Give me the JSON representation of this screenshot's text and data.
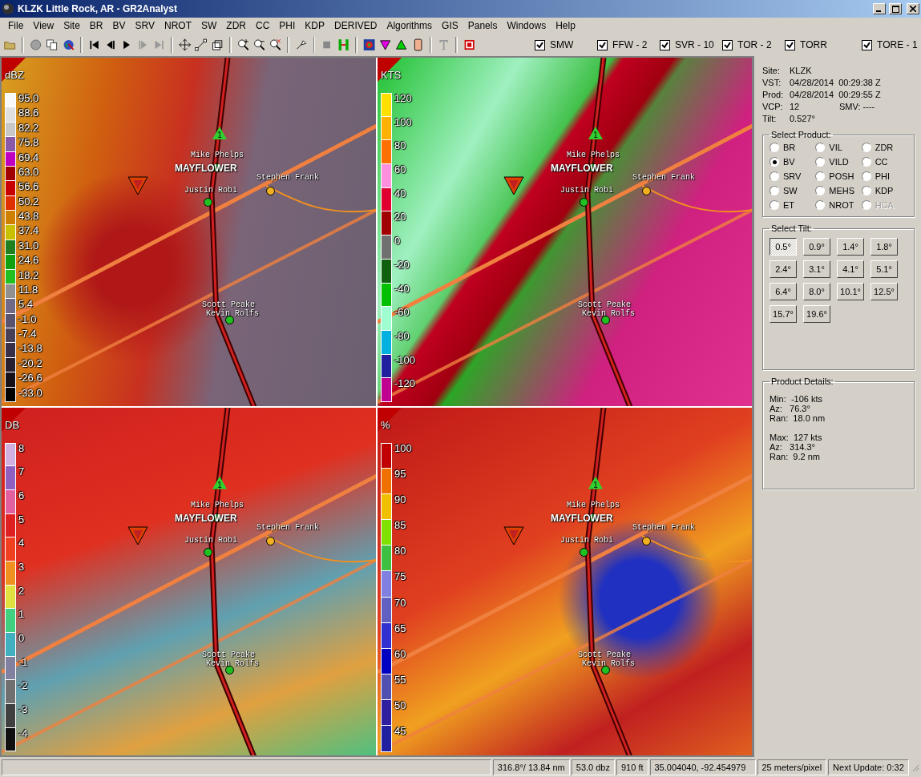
{
  "window": {
    "title": "KLZK Little Rock, AR - GR2Analyst"
  },
  "menu": [
    "File",
    "View",
    "Site",
    "BR",
    "BV",
    "SRV",
    "NROT",
    "SW",
    "ZDR",
    "CC",
    "PHI",
    "KDP",
    "DERIVED",
    "Algorithms",
    "GIS",
    "Panels",
    "Windows",
    "Help"
  ],
  "warning_toggles": [
    {
      "label": "SMW",
      "checked": true
    },
    {
      "label": "FFW - 2",
      "checked": true
    },
    {
      "label": "SVR - 10",
      "checked": true
    },
    {
      "label": "TOR - 2",
      "checked": true
    },
    {
      "label": "TORR",
      "checked": true
    },
    {
      "label": "TORE - 1",
      "checked": true
    }
  ],
  "panels": [
    {
      "unit": "dBZ",
      "scale": [
        {
          "label": "95.0",
          "color": "#f8f8f8"
        },
        {
          "label": "88.6",
          "color": "#e0e0e0"
        },
        {
          "label": "82.2",
          "color": "#c8c8c8"
        },
        {
          "label": "75.8",
          "color": "#8a5aa8"
        },
        {
          "label": "69.4",
          "color": "#c000c0"
        },
        {
          "label": "63.0",
          "color": "#a00000"
        },
        {
          "label": "56.6",
          "color": "#c80000"
        },
        {
          "label": "50.2",
          "color": "#e03000"
        },
        {
          "label": "43.8",
          "color": "#d08000"
        },
        {
          "label": "37.4",
          "color": "#c8c000"
        },
        {
          "label": "31.0",
          "color": "#208020"
        },
        {
          "label": "24.6",
          "color": "#10a010"
        },
        {
          "label": "18.2",
          "color": "#20c020"
        },
        {
          "label": "11.8",
          "color": "#909090"
        },
        {
          "label": "5.4",
          "color": "#706a88"
        },
        {
          "label": "-1.0",
          "color": "#5a5470"
        },
        {
          "label": "-7.4",
          "color": "#484058"
        },
        {
          "label": "-13.8",
          "color": "#383048"
        },
        {
          "label": "-20.2",
          "color": "#282030"
        },
        {
          "label": "-26.6",
          "color": "#181018"
        },
        {
          "label": "-33.0",
          "color": "#000000"
        }
      ],
      "map_labels": [
        {
          "kind": "marker",
          "text": "1"
        },
        {
          "kind": "spotter",
          "text": "Mike Phelps",
          "color": "#20c020"
        },
        {
          "kind": "town",
          "text": "MAYFLOWER"
        },
        {
          "kind": "spotter",
          "text": "Stephen Frank",
          "color": "#f0b020"
        },
        {
          "kind": "spotter",
          "text": "Justin Robi",
          "color": "#20c020"
        },
        {
          "kind": "spotter",
          "text": "Scott Peake",
          "color": "#20c020"
        },
        {
          "kind": "label",
          "text": "Kevin Rolfs"
        }
      ]
    },
    {
      "unit": "KTS",
      "scale": [
        {
          "label": "120",
          "color": "#ffe000"
        },
        {
          "label": "100",
          "color": "#ffb000"
        },
        {
          "label": "80",
          "color": "#ff7000"
        },
        {
          "label": "60",
          "color": "#ff90e0"
        },
        {
          "label": "40",
          "color": "#e00030"
        },
        {
          "label": "20",
          "color": "#a00000"
        },
        {
          "label": "0",
          "color": "#707070"
        },
        {
          "label": "-20",
          "color": "#106010"
        },
        {
          "label": "-40",
          "color": "#00c000"
        },
        {
          "label": "-60",
          "color": "#a0ffd0"
        },
        {
          "label": "-80",
          "color": "#00b0e0"
        },
        {
          "label": "-100",
          "color": "#2020a0"
        },
        {
          "label": "-120",
          "color": "#c00090"
        }
      ],
      "map_labels": [
        {
          "kind": "marker",
          "text": "1"
        },
        {
          "kind": "spotter",
          "text": "Mike Phelps",
          "color": "#20c020"
        },
        {
          "kind": "town",
          "text": "MAYFLOWER"
        },
        {
          "kind": "spotter",
          "text": "Stephen Frank",
          "color": "#f0b020"
        },
        {
          "kind": "spotter",
          "text": "Justin Robi",
          "color": "#20c020"
        },
        {
          "kind": "spotter",
          "text": "Scott Peake",
          "color": "#20c020"
        },
        {
          "kind": "label",
          "text": "Kevin Rolfs"
        }
      ]
    },
    {
      "unit": "DB",
      "scale": [
        {
          "label": "8",
          "color": "#d0b0e0"
        },
        {
          "label": "7",
          "color": "#9060c0"
        },
        {
          "label": "6",
          "color": "#e060a0"
        },
        {
          "label": "5",
          "color": "#e02020"
        },
        {
          "label": "4",
          "color": "#f04020"
        },
        {
          "label": "3",
          "color": "#f09020"
        },
        {
          "label": "2",
          "color": "#e0e040"
        },
        {
          "label": "1",
          "color": "#40d080"
        },
        {
          "label": "0",
          "color": "#40b0c0"
        },
        {
          "label": "-1",
          "color": "#8080a0"
        },
        {
          "label": "-2",
          "color": "#707070"
        },
        {
          "label": "-3",
          "color": "#404040"
        },
        {
          "label": "-4",
          "color": "#101010"
        }
      ],
      "map_labels": [
        {
          "kind": "marker",
          "text": "1"
        },
        {
          "kind": "spotter",
          "text": "Mike Phelps",
          "color": "#20c020"
        },
        {
          "kind": "town",
          "text": "MAYFLOWER"
        },
        {
          "kind": "spotter",
          "text": "Stephen Frank",
          "color": "#f0b020"
        },
        {
          "kind": "spotter",
          "text": "Justin Robi",
          "color": "#20c020"
        },
        {
          "kind": "spotter",
          "text": "Scott Peake",
          "color": "#20c020"
        },
        {
          "kind": "label",
          "text": "Kevin Rolfs"
        }
      ]
    },
    {
      "unit": "%",
      "scale": [
        {
          "label": "100",
          "color": "#c00000"
        },
        {
          "label": "95",
          "color": "#f07000"
        },
        {
          "label": "90",
          "color": "#f0c000"
        },
        {
          "label": "85",
          "color": "#80e000"
        },
        {
          "label": "80",
          "color": "#40c040"
        },
        {
          "label": "75",
          "color": "#8080e0"
        },
        {
          "label": "70",
          "color": "#6060c0"
        },
        {
          "label": "65",
          "color": "#3030d0"
        },
        {
          "label": "60",
          "color": "#0000c0"
        },
        {
          "label": "55",
          "color": "#5050b0"
        },
        {
          "label": "50",
          "color": "#3020a0"
        },
        {
          "label": "45",
          "color": "#2020a0"
        }
      ],
      "map_labels": [
        {
          "kind": "marker",
          "text": "1"
        },
        {
          "kind": "spotter",
          "text": "Mike Phelps",
          "color": "#20c020"
        },
        {
          "kind": "town",
          "text": "MAYFLOWER"
        },
        {
          "kind": "spotter",
          "text": "Stephen Frank",
          "color": "#f0b020"
        },
        {
          "kind": "spotter",
          "text": "Justin Robi",
          "color": "#20c020"
        },
        {
          "kind": "spotter",
          "text": "Scott Peake",
          "color": "#20c020"
        },
        {
          "kind": "label",
          "text": "Kevin Rolfs"
        }
      ]
    }
  ],
  "info": [
    {
      "label": "Site:",
      "value": "KLZK"
    },
    {
      "label": "VST:",
      "value": "04/28/2014  00:29:38 Z"
    },
    {
      "label": "Prod:",
      "value": "04/28/2014  00:29:55 Z"
    },
    {
      "label": "VCP:",
      "value": "12",
      "extra_label": "SMV:",
      "extra_value": "----"
    },
    {
      "label": "Tilt:",
      "value": "0.527°"
    }
  ],
  "product_group": {
    "title": "Select Product:",
    "options": [
      {
        "label": "BR",
        "selected": false,
        "disabled": false
      },
      {
        "label": "VIL",
        "selected": false,
        "disabled": false
      },
      {
        "label": "ZDR",
        "selected": false,
        "disabled": false
      },
      {
        "label": "BV",
        "selected": true,
        "disabled": false
      },
      {
        "label": "VILD",
        "selected": false,
        "disabled": false
      },
      {
        "label": "CC",
        "selected": false,
        "disabled": false
      },
      {
        "label": "SRV",
        "selected": false,
        "disabled": false
      },
      {
        "label": "POSH",
        "selected": false,
        "disabled": false
      },
      {
        "label": "PHI",
        "selected": false,
        "disabled": false
      },
      {
        "label": "SW",
        "selected": false,
        "disabled": false
      },
      {
        "label": "MEHS",
        "selected": false,
        "disabled": false
      },
      {
        "label": "KDP",
        "selected": false,
        "disabled": false
      },
      {
        "label": "ET",
        "selected": false,
        "disabled": false
      },
      {
        "label": "NROT",
        "selected": false,
        "disabled": false
      },
      {
        "label": "HCA",
        "selected": false,
        "disabled": true
      }
    ]
  },
  "tilt_group": {
    "title": "Select Tilt:",
    "tilts": [
      {
        "label": "0.5°",
        "selected": true
      },
      {
        "label": "0.9°",
        "selected": false
      },
      {
        "label": "1.4°",
        "selected": false
      },
      {
        "label": "1.8°",
        "selected": false
      },
      {
        "label": "2.4°",
        "selected": false
      },
      {
        "label": "3.1°",
        "selected": false
      },
      {
        "label": "4.1°",
        "selected": false
      },
      {
        "label": "5.1°",
        "selected": false
      },
      {
        "label": "6.4°",
        "selected": false
      },
      {
        "label": "8.0°",
        "selected": false
      },
      {
        "label": "10.1°",
        "selected": false
      },
      {
        "label": "12.5°",
        "selected": false
      },
      {
        "label": "15.7°",
        "selected": false
      },
      {
        "label": "19.6°",
        "selected": false
      }
    ]
  },
  "details_group": {
    "title": "Product Details:",
    "blocks": [
      [
        "Min:  -106 kts",
        "Az:   76.3°",
        "Ran:  18.0 nm"
      ],
      [
        "Max:  127 kts",
        "Az:   314.3°",
        "Ran:  9.2 nm"
      ]
    ]
  },
  "status_bar": [
    "316.8°/ 13.84 nm",
    "53.0 dbz",
    "910 ft",
    "35.004040, -92.454979",
    "25 meters/pixel",
    "Next Update: 0:32"
  ]
}
